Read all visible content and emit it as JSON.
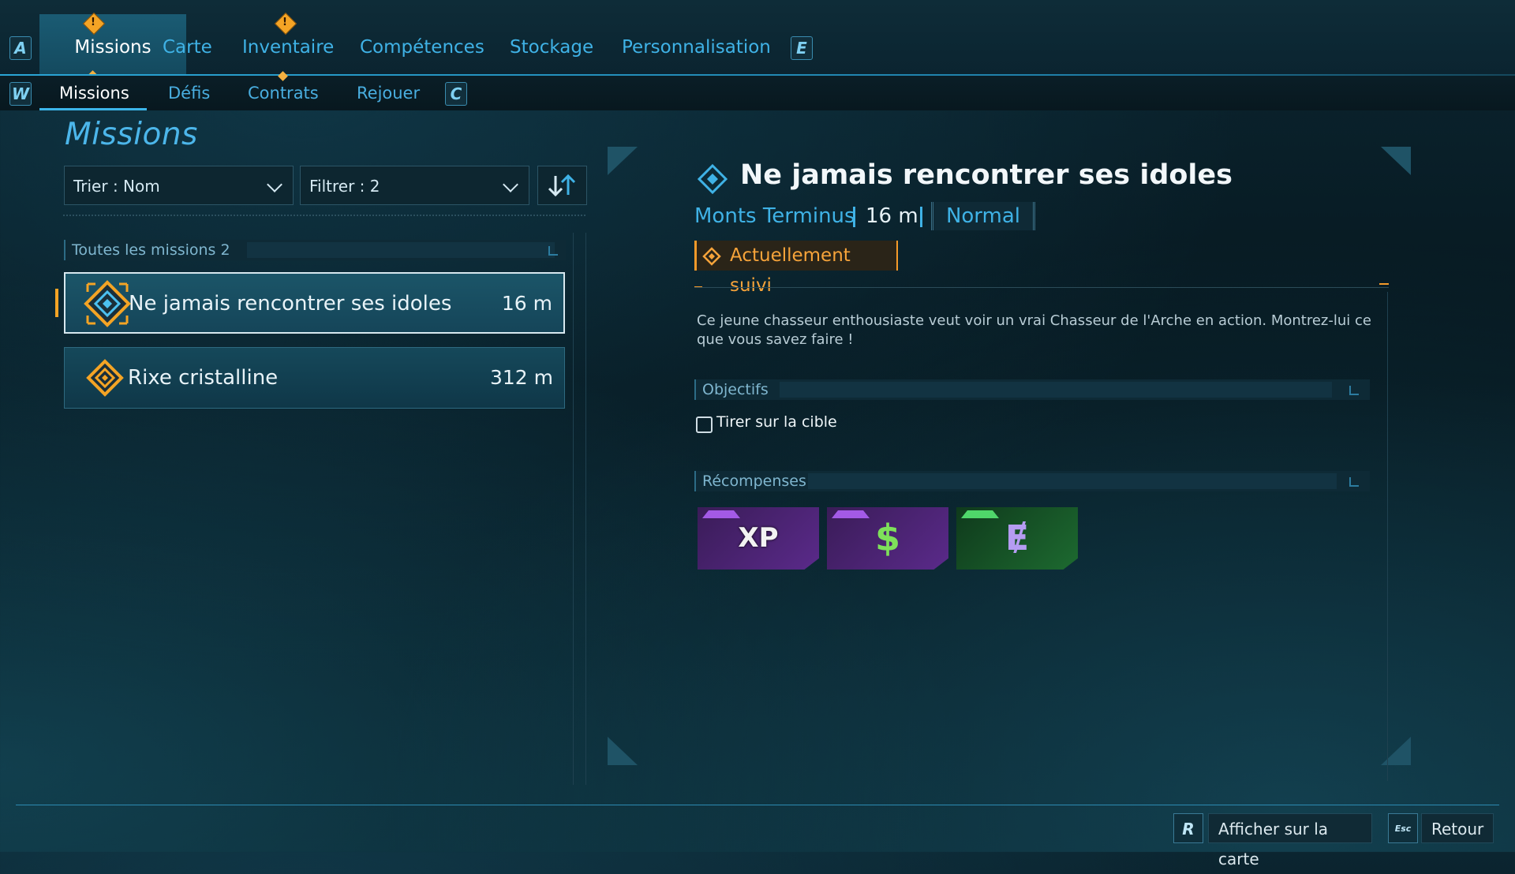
{
  "top_tabs": {
    "left_key": "A",
    "right_key": "E",
    "items": [
      {
        "label": "Missions",
        "active": true,
        "alert": true
      },
      {
        "label": "Carte",
        "active": false,
        "alert": false
      },
      {
        "label": "Inventaire",
        "active": false,
        "alert": true
      },
      {
        "label": "Compétences",
        "active": false,
        "alert": false
      },
      {
        "label": "Stockage",
        "active": false,
        "alert": false
      },
      {
        "label": "Personnalisation",
        "active": false,
        "alert": false
      }
    ],
    "alert_glyph": "!"
  },
  "sub_tabs": {
    "left_key": "W",
    "right_key": "C",
    "items": [
      {
        "label": "Missions",
        "active": true
      },
      {
        "label": "Défis",
        "active": false
      },
      {
        "label": "Contrats",
        "active": false
      },
      {
        "label": "Rejouer",
        "active": false
      }
    ]
  },
  "left_panel": {
    "title": "Missions",
    "sort_label": "Trier : Nom",
    "filter_label": "Filtrer : 2",
    "sort_direction_icon": "sort-down-up-icon",
    "group_header": "Toutes les missions 2",
    "missions": [
      {
        "name": "Ne jamais rencontrer ses idoles",
        "distance": "16 m",
        "selected": true,
        "icon": "tracked-mission-diamond-icon"
      },
      {
        "name": "Rixe cristalline",
        "distance": "312 m",
        "selected": false,
        "icon": "mission-diamond-icon"
      }
    ]
  },
  "detail": {
    "title": "Ne jamais rencontrer ses idoles",
    "location": "Monts Terminus",
    "distance": "16 m",
    "difficulty": "Normal",
    "tracked_label": "Actuellement suivi",
    "description": "Ce jeune chasseur enthousiaste veut voir un vrai Chasseur de l'Arche en action. Montrez-lui ce que vous savez faire !",
    "objectives_header": "Objectifs",
    "objectives": [
      {
        "text": "Tirer sur la cible",
        "done": false
      }
    ],
    "rewards_header": "Récompenses",
    "rewards": [
      {
        "label": "XP",
        "kind": "xp",
        "rarity_color": "#8a2bd0"
      },
      {
        "label": "$",
        "kind": "money",
        "rarity_color": "#8a2bd0"
      },
      {
        "label": "Ɇ",
        "kind": "eridium",
        "rarity_color": "#25a03a"
      }
    ]
  },
  "bottom_bar": {
    "map_key": "R",
    "map_label": "Afficher sur la carte",
    "back_key": "Esc",
    "back_label": "Retour"
  },
  "colors": {
    "accent_blue": "#3fb2e6",
    "alert_orange": "#f4a425",
    "tracked_orange": "#f6a33a"
  }
}
